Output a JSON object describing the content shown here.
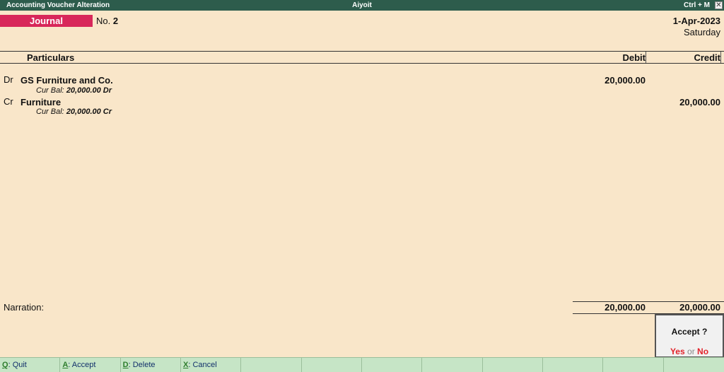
{
  "titlebar": {
    "left": "Accounting Voucher  Alteration",
    "center": "Aiyoit",
    "shortcut": "Ctrl + M",
    "close": "✕"
  },
  "voucher": {
    "type": "Journal",
    "no_label": "No.",
    "no_value": "2",
    "date": "1-Apr-2023",
    "day": "Saturday"
  },
  "columns": {
    "particulars": "Particulars",
    "debit": "Debit",
    "credit": "Credit"
  },
  "entries": [
    {
      "drcr": "Dr",
      "ledger": "GS Furniture and Co.",
      "bal_label": "Cur Bal:",
      "bal_value": "20,000.00 Dr",
      "debit": "20,000.00",
      "credit": ""
    },
    {
      "drcr": "Cr",
      "ledger": "Furniture",
      "bal_label": "Cur Bal:",
      "bal_value": "20,000.00 Cr",
      "debit": "",
      "credit": "20,000.00"
    }
  ],
  "narration_label": "Narration:",
  "totals": {
    "debit": "20,000.00",
    "credit": "20,000.00"
  },
  "accept_dialog": {
    "question": "Accept ?",
    "yes": "Yes",
    "or": "or",
    "no": "No"
  },
  "fkeys": [
    {
      "key": "Q",
      "label": "Quit"
    },
    {
      "key": "A",
      "label": "Accept"
    },
    {
      "key": "D",
      "label": "Delete"
    },
    {
      "key": "X",
      "label": "Cancel"
    },
    {
      "key": "",
      "label": ""
    },
    {
      "key": "",
      "label": ""
    },
    {
      "key": "",
      "label": ""
    },
    {
      "key": "",
      "label": ""
    },
    {
      "key": "",
      "label": ""
    },
    {
      "key": "",
      "label": ""
    },
    {
      "key": "",
      "label": ""
    },
    {
      "key": "",
      "label": ""
    }
  ],
  "colors": {
    "background": "#f9e6c9",
    "titlebar": "#2d5c4c",
    "voucher_type_bg": "#d8275a",
    "fkey_bar": "#c6e5c6",
    "yes_no": "#e2232b"
  }
}
